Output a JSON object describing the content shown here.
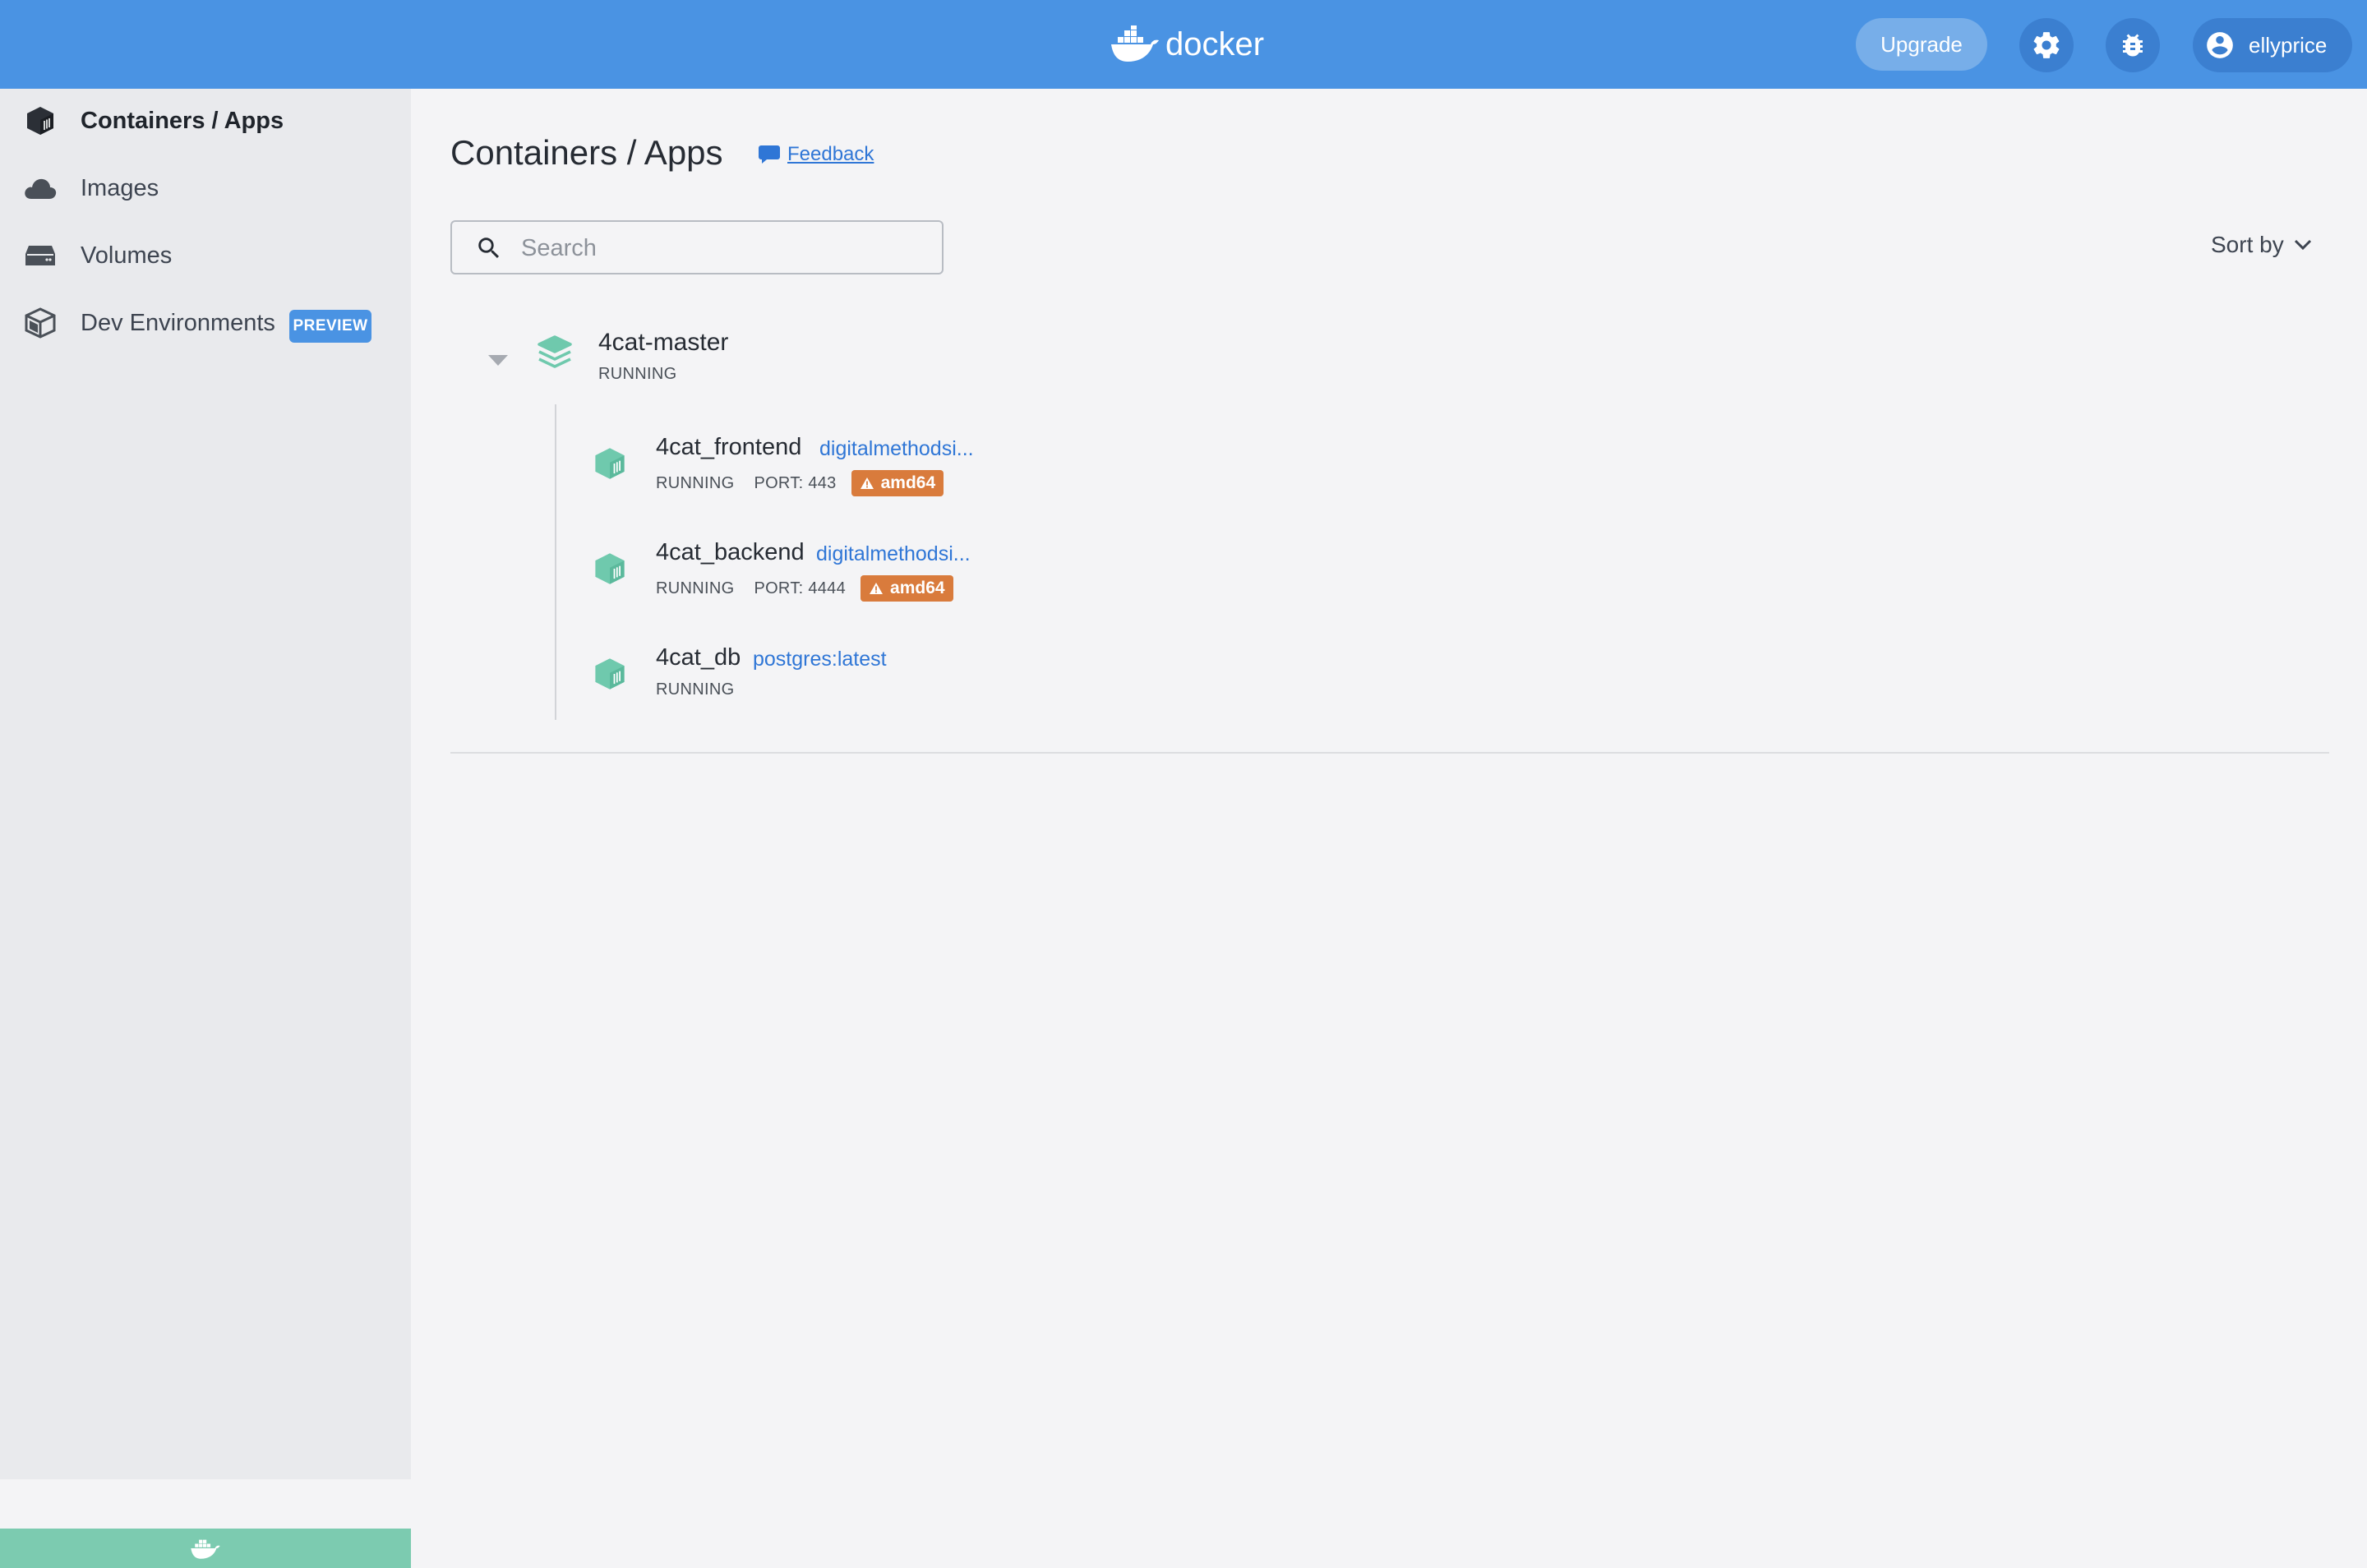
{
  "header": {
    "logo_text": "docker",
    "upgrade_label": "Upgrade",
    "username": "ellyprice",
    "colors": {
      "bar": "#4a93e3",
      "button": "#3b7fd0"
    }
  },
  "sidebar": {
    "items": [
      {
        "label": "Containers / Apps",
        "icon": "container-icon",
        "active": true
      },
      {
        "label": "Images",
        "icon": "cloud-icon",
        "active": false
      },
      {
        "label": "Volumes",
        "icon": "volume-icon",
        "active": false
      },
      {
        "label": "Dev Environments",
        "icon": "dev-environment-icon",
        "active": false,
        "badge": "PREVIEW"
      }
    ],
    "footer_icon": "docker-whale-icon",
    "footer_color": "#7ccbb0"
  },
  "main": {
    "title": "Containers / Apps",
    "feedback_label": "Feedback",
    "search_placeholder": "Search",
    "sort_label": "Sort by",
    "group": {
      "name": "4cat-master",
      "status": "RUNNING",
      "containers": [
        {
          "name": "4cat_frontend",
          "image": "digitalmethodsi...",
          "status": "RUNNING",
          "port": "PORT: 443",
          "arch": "amd64"
        },
        {
          "name": "4cat_backend",
          "image": "digitalmethodsi...",
          "status": "RUNNING",
          "port": "PORT: 4444",
          "arch": "amd64"
        },
        {
          "name": "4cat_db",
          "image": "postgres:latest",
          "status": "RUNNING"
        }
      ]
    },
    "colors": {
      "link": "#2f76d6",
      "running_icon": "#6fc9ad",
      "warning_badge": "#d97b3c"
    }
  }
}
